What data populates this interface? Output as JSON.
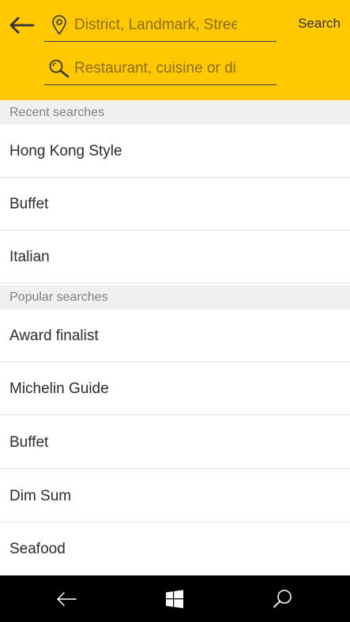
{
  "header": {
    "back_icon": "back-arrow-icon",
    "search_action_label": "Search",
    "location_field": {
      "icon": "map-pin-icon",
      "value": "",
      "placeholder": "District, Landmark, Street"
    },
    "query_field": {
      "icon": "search-icon",
      "value": "",
      "placeholder": "Restaurant, cuisine or dish"
    }
  },
  "recent": {
    "title": "Recent searches",
    "items": [
      {
        "label": "Hong Kong Style"
      },
      {
        "label": "Buffet"
      },
      {
        "label": "Italian"
      }
    ]
  },
  "popular": {
    "title": "Popular searches",
    "items": [
      {
        "label": "Award finalist"
      },
      {
        "label": "Michelin Guide"
      },
      {
        "label": "Buffet"
      },
      {
        "label": "Dim Sum"
      },
      {
        "label": "Seafood"
      }
    ]
  },
  "system_nav": {
    "back_icon": "system-back-icon",
    "home_icon": "windows-logo-icon",
    "search_icon": "system-search-icon"
  },
  "colors": {
    "header_bg": "#FFC800",
    "section_bg": "#F0F0F0",
    "navbar_bg": "#000000"
  }
}
